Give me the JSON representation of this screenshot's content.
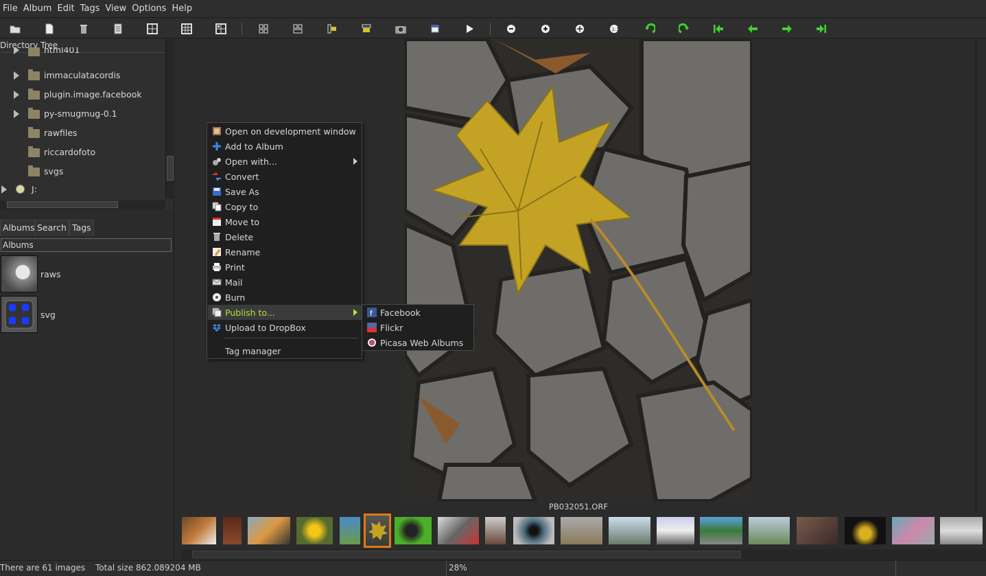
{
  "menubar": {
    "items": [
      "File",
      "Album",
      "Edit",
      "Tags",
      "View",
      "Options",
      "Help"
    ]
  },
  "toolbar": {
    "icons": [
      "open-folder-icon",
      "new-file-icon",
      "trash-icon",
      "properties-icon",
      "grid-2x2-icon",
      "grid-3x3-icon",
      "grid-4x4-icon",
      "layout-1-icon",
      "layout-2-icon",
      "layout-3-icon",
      "layout-4-icon",
      "camera-icon",
      "fullscreen-icon",
      "play-icon",
      "zoom-out-icon",
      "zoom-in-icon",
      "zoom-fit-icon",
      "zoom-100-icon",
      "rotate-left-icon",
      "rotate-right-icon",
      "first-icon",
      "previous-icon",
      "next-icon",
      "last-icon"
    ]
  },
  "dirtree": {
    "header": "Directory Tree",
    "items": [
      {
        "label": "html401",
        "expander": true
      },
      {
        "label": "immaculatacordis",
        "expander": true
      },
      {
        "label": "plugin.image.facebook",
        "expander": true
      },
      {
        "label": "py-smugmug-0.1",
        "expander": true
      },
      {
        "label": "rawfiles",
        "expander": false
      },
      {
        "label": "riccardofoto",
        "expander": false
      },
      {
        "label": "svgs",
        "expander": false
      },
      {
        "label": "J:",
        "expander": true
      }
    ]
  },
  "tabs": [
    "Albums",
    "Search",
    "Tags"
  ],
  "albums": {
    "field_value": "Albums",
    "items": [
      {
        "label": "raws"
      },
      {
        "label": "svg"
      }
    ]
  },
  "viewer": {
    "filename": "PB032051.ORF"
  },
  "context_menu": {
    "items": [
      {
        "label": "Open on development window",
        "icon": "develop-icon"
      },
      {
        "label": "Add to Album",
        "icon": "plus-icon"
      },
      {
        "label": "Open with...",
        "icon": "gears-icon"
      },
      {
        "label": "Convert",
        "icon": "convert-icon"
      },
      {
        "label": "Save As",
        "icon": "save-icon"
      },
      {
        "label": "Copy to",
        "icon": "copy-icon"
      },
      {
        "label": "Move to",
        "icon": "move-icon"
      },
      {
        "label": "Delete",
        "icon": "delete-icon"
      },
      {
        "label": "Rename",
        "icon": "rename-icon"
      },
      {
        "label": "Print",
        "icon": "print-icon"
      },
      {
        "label": "Mail",
        "icon": "mail-icon"
      },
      {
        "label": "Burn",
        "icon": "disc-icon"
      },
      {
        "label": "Publish to...",
        "icon": "publish-icon"
      },
      {
        "label": "Upload to DropBox",
        "icon": "dropbox-icon"
      },
      {
        "label": "Tag manager",
        "icon": ""
      }
    ],
    "highlight_color": "#b6e03b"
  },
  "submenu": {
    "items": [
      {
        "label": "Facebook",
        "icon": "facebook-icon"
      },
      {
        "label": "Flickr",
        "icon": "flickr-icon"
      },
      {
        "label": "Picasa Web Albums",
        "icon": "picasa-icon"
      }
    ]
  },
  "statusbar": {
    "count": "There are 61 images",
    "size": "Total size 862.089204 MB",
    "zoom": "28%"
  },
  "colors": {
    "selected_thumb_border": "#e07a10",
    "nav_arrow": "#3fd12e"
  }
}
